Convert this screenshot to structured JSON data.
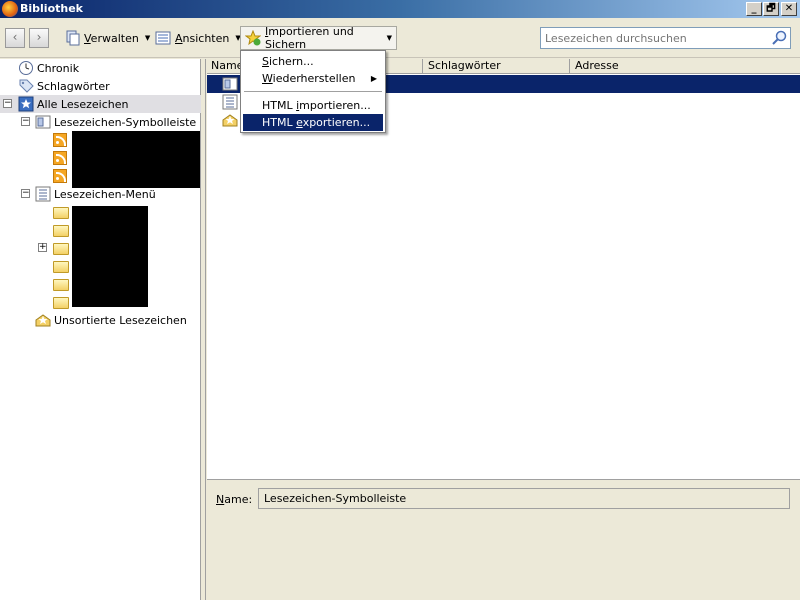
{
  "window": {
    "title": "Bibliothek",
    "controls": [
      "_",
      "🗗",
      "✕"
    ]
  },
  "toolbar": {
    "back": "‹",
    "forward": "›",
    "verwalten": {
      "accel": "V",
      "rest": "erwalten"
    },
    "ansichten": {
      "accel": "A",
      "rest": "nsichten"
    },
    "importieren": {
      "accel": "I",
      "rest": "mportieren und Sichern"
    },
    "search_placeholder": "Lesezeichen durchsuchen"
  },
  "tree": {
    "chronik": "Chronik",
    "schlagwoerter": "Schlagwörter",
    "alle": "Alle Lesezeichen",
    "symbolleiste": "Lesezeichen-Symbolleiste",
    "menu": "Lesezeichen-Menü",
    "unsortiert": "Unsortierte Lesezeichen"
  },
  "columns": [
    "Name",
    "Schlagwörter",
    "Adresse"
  ],
  "menu": {
    "sichern": {
      "accel": "S",
      "rest": "ichern..."
    },
    "wiederherstellen": {
      "accel": "W",
      "rest": "iederherstellen"
    },
    "html_import": {
      "pre": "HTML ",
      "accel": "i",
      "rest": "mportieren..."
    },
    "html_export": {
      "pre": "HTML ",
      "accel": "e",
      "rest": "xportieren..."
    }
  },
  "details": {
    "name_label_accel": "N",
    "name_label_rest": "ame:",
    "name_value": "Lesezeichen-Symbolleiste"
  }
}
